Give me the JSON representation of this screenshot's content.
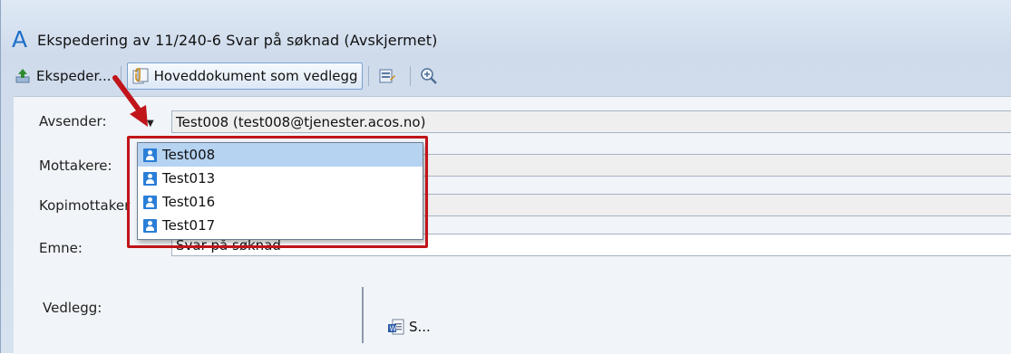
{
  "window": {
    "title": "Ekspedering av 11/240-6 Svar på søknad (Avskjermet)"
  },
  "toolbar": {
    "ekspeder_label": "Ekspeder...",
    "hoveddokument_label": "Hoveddokument som vedlegg"
  },
  "form": {
    "avsender_label": "Avsender:",
    "avsender_value": "Test008 (test008@tjenester.acos.no)",
    "mottakere_label": "Mottakere:",
    "kopimottaker_label": "Kopimottaker",
    "emne_label": "Emne:",
    "emne_value": "Svar på søknad",
    "vedlegg_label": "Vedlegg:",
    "attachment_name": "S..."
  },
  "dropdown": {
    "items": [
      {
        "label": "Test008",
        "selected": true
      },
      {
        "label": "Test013"
      },
      {
        "label": "Test016"
      },
      {
        "label": "Test017"
      }
    ]
  },
  "colors": {
    "highlight": "#c0151a",
    "selection": "#b6d3f1",
    "user_icon": "#2a7ed7"
  }
}
